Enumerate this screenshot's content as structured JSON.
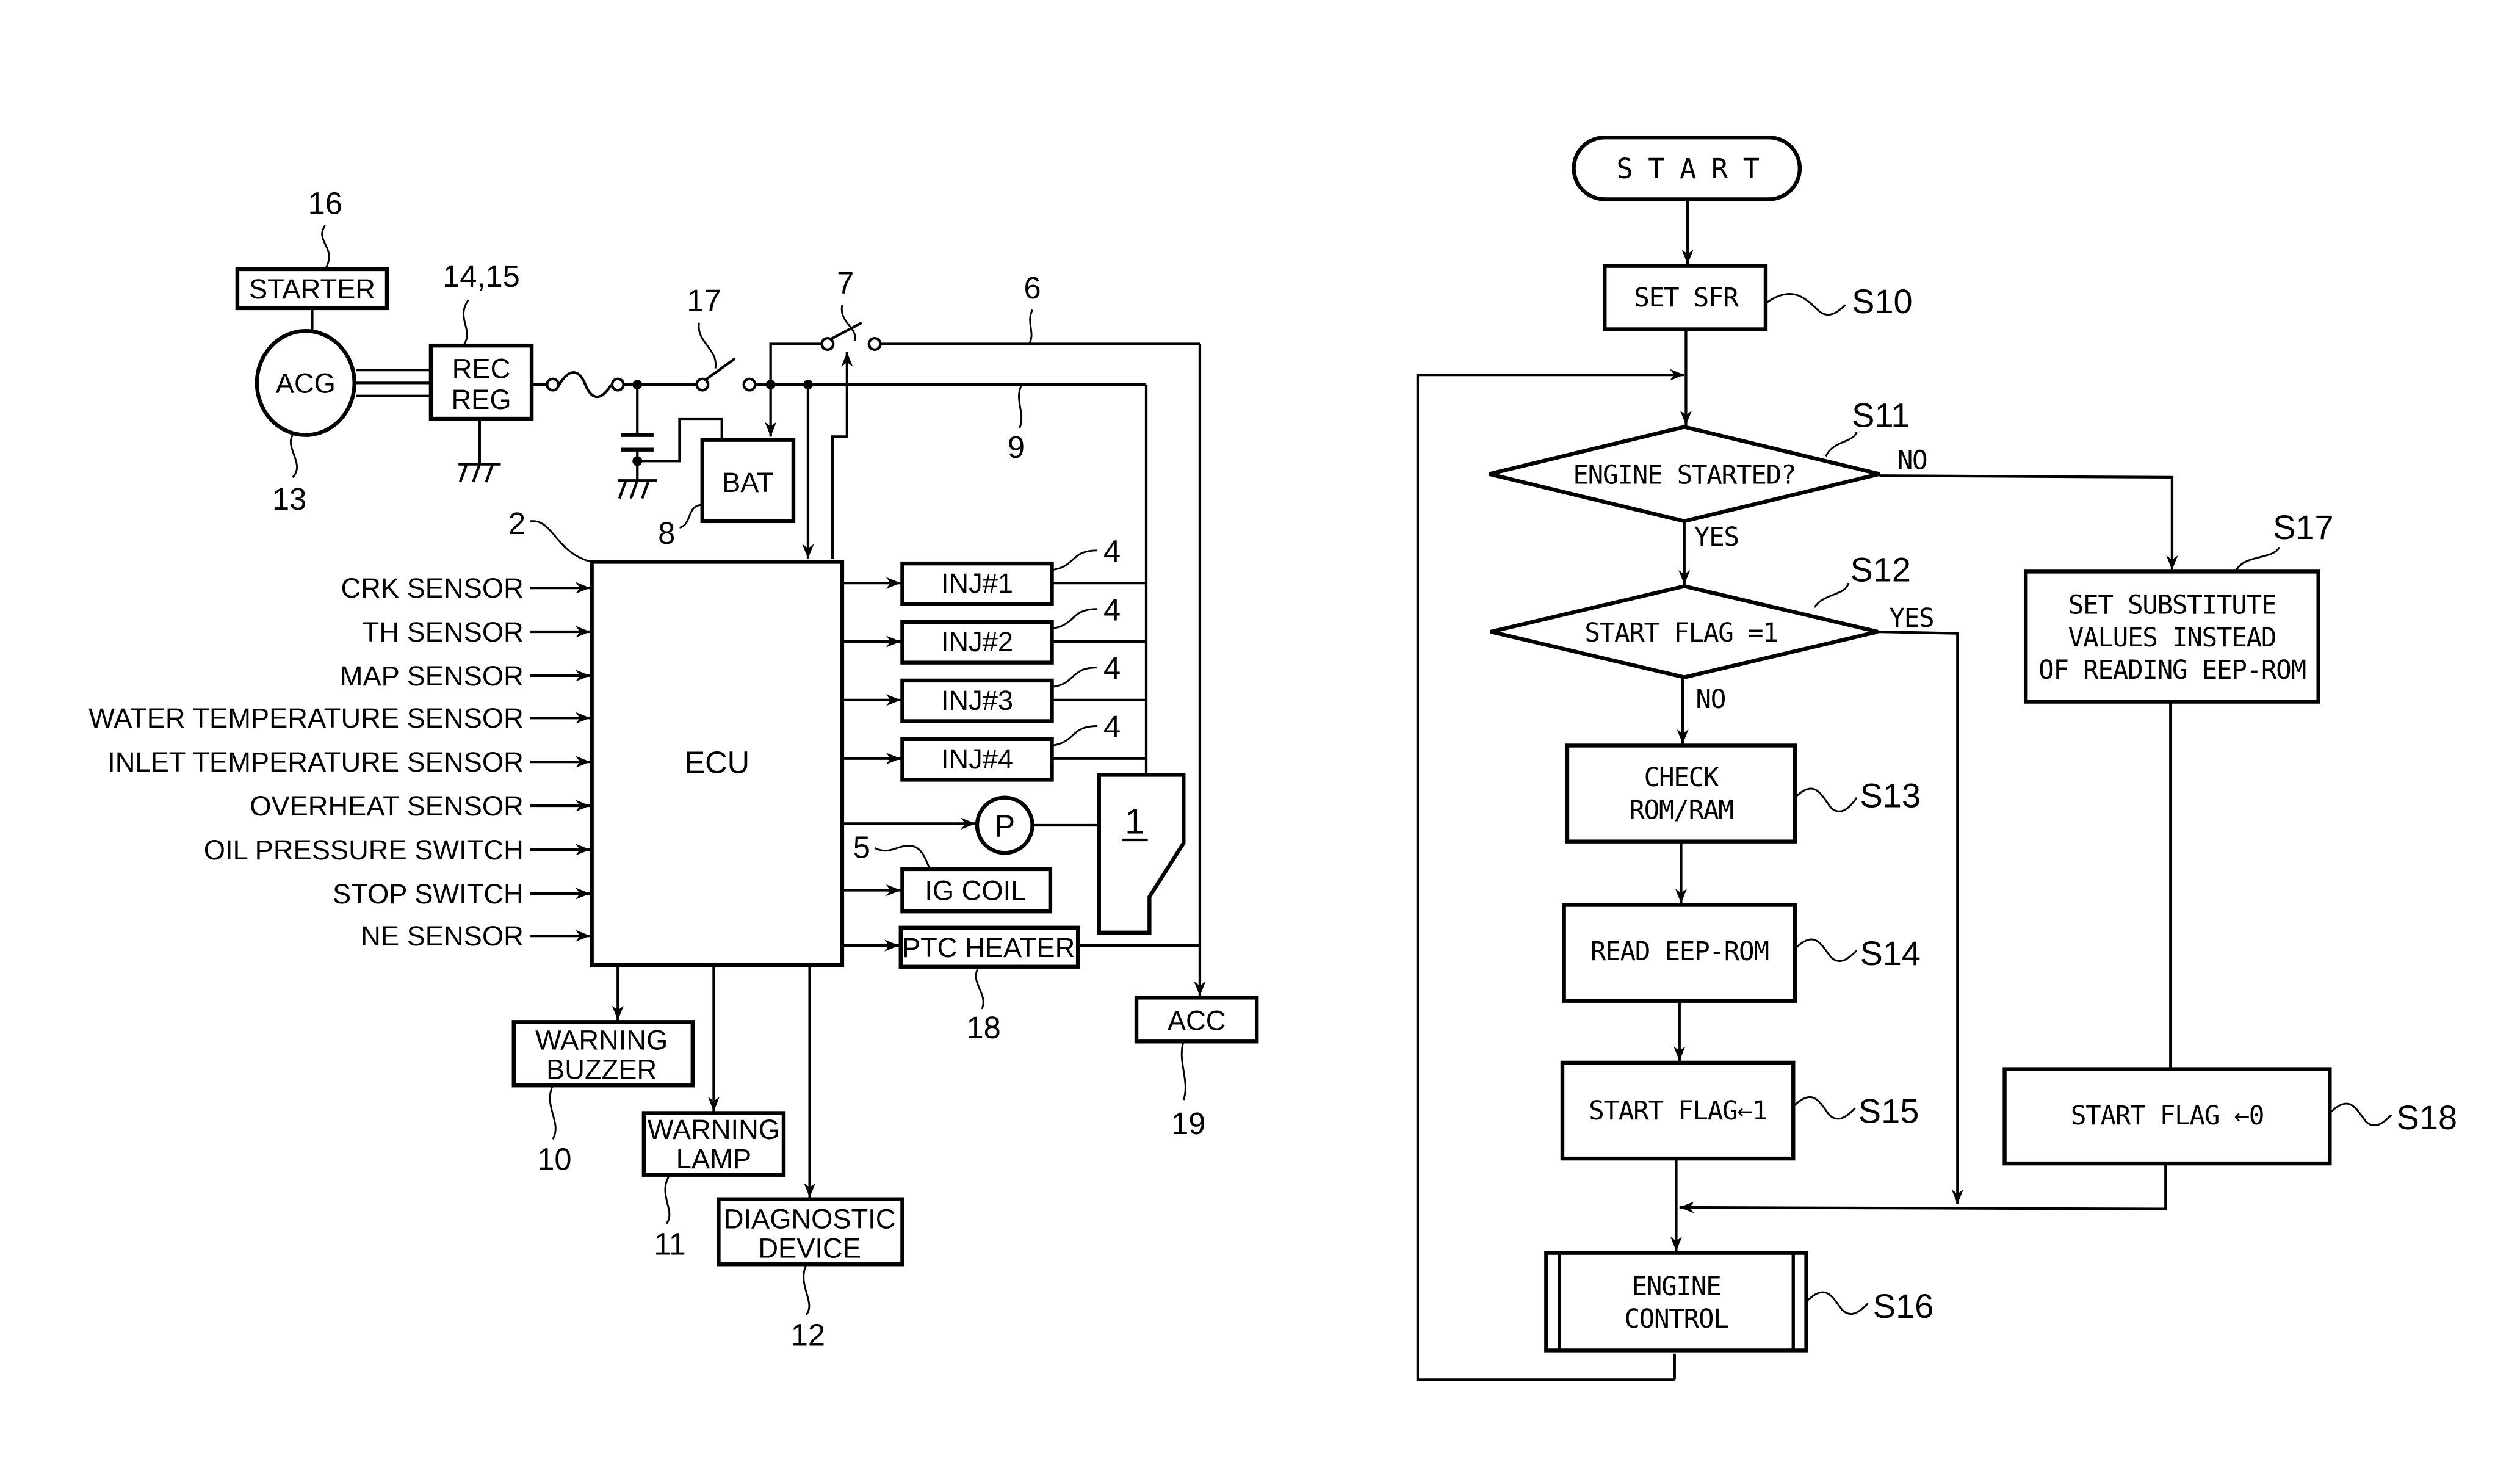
{
  "figure": {
    "circuit": {
      "ecu": {
        "label": "ECU",
        "ref": "2"
      },
      "starter": {
        "label": "STARTER",
        "ref": "16"
      },
      "acg": {
        "label": "ACG",
        "ref": "13"
      },
      "rec_reg": {
        "line1": "REC",
        "line2": "REG",
        "ref": "14,15"
      },
      "battery": {
        "label": "BAT",
        "ref": "8"
      },
      "switch_17": {
        "ref": "17"
      },
      "switch_7": {
        "ref": "7"
      },
      "line_6": {
        "ref": "6"
      },
      "line_9": {
        "ref": "9"
      },
      "sensors": [
        "CRK SENSOR",
        "TH SENSOR",
        "MAP SENSOR",
        "WATER TEMPERATURE SENSOR",
        "INLET TEMPERATURE SENSOR",
        "OVERHEAT SENSOR",
        "OIL PRESSURE SWITCH",
        "STOP SWITCH",
        "NE SENSOR"
      ],
      "injectors": [
        {
          "label": "INJ#1",
          "ref": "4"
        },
        {
          "label": "INJ#2",
          "ref": "4"
        },
        {
          "label": "INJ#3",
          "ref": "4"
        },
        {
          "label": "INJ#4",
          "ref": "4"
        }
      ],
      "pump": {
        "label": "P"
      },
      "engine": {
        "ref": "1"
      },
      "ig_coil": {
        "label": "IG COIL",
        "ref": "5"
      },
      "ptc_heater": {
        "label": "PTC HEATER",
        "ref": "18"
      },
      "acc": {
        "label": "ACC",
        "ref": "19"
      },
      "warning_buzzer": {
        "line1": "WARNING",
        "line2": "BUZZER",
        "ref": "10"
      },
      "warning_lamp": {
        "line1": "WARNING",
        "line2": "LAMP",
        "ref": "11"
      },
      "diagnostic_device": {
        "line1": "DIAGNOSTIC",
        "line2": "DEVICE",
        "ref": "12"
      }
    },
    "flowchart": {
      "start": "S T A R T",
      "steps": {
        "s10": {
          "text": "SET SFR",
          "ref": "S10"
        },
        "s11": {
          "text": "ENGINE STARTED?",
          "ref": "S11",
          "yes": "YES",
          "no": "NO"
        },
        "s12": {
          "text": "START FLAG =1",
          "ref": "S12",
          "yes": "YES",
          "no": "NO"
        },
        "s13": {
          "line1": "CHECK",
          "line2": "ROM/RAM",
          "ref": "S13"
        },
        "s14": {
          "text": "READ EEP-ROM",
          "ref": "S14"
        },
        "s15": {
          "text": "START FLAG←1",
          "ref": "S15"
        },
        "s16": {
          "line1": "ENGINE",
          "line2": "CONTROL",
          "ref": "S16"
        },
        "s17": {
          "line1": "SET SUBSTITUTE",
          "line2": "VALUES INSTEAD",
          "line3": "OF READING EEP-ROM",
          "ref": "S17"
        },
        "s18": {
          "text": "START FLAG ←0",
          "ref": "S18"
        }
      }
    }
  }
}
